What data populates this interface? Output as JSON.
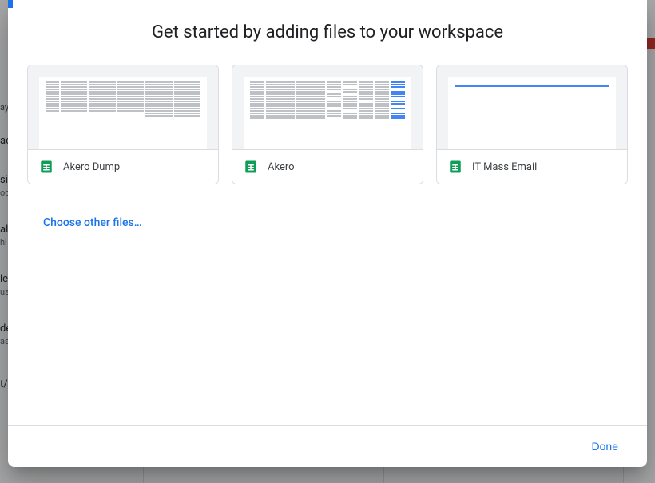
{
  "modal": {
    "title": "Get started by adding files to your workspace",
    "choose_other": "Choose other files…",
    "done_label": "Done"
  },
  "files": [
    {
      "name": "Akero Dump",
      "icon": "sheets",
      "thumb_style": "dense"
    },
    {
      "name": "Akero",
      "icon": "sheets",
      "thumb_style": "dense-right"
    },
    {
      "name": "IT Mass Email",
      "icon": "sheets",
      "thumb_style": "sparse"
    }
  ],
  "colors": {
    "primary": "#1a73e8",
    "sheets_green": "#0f9d58",
    "border": "#dadce0"
  }
}
